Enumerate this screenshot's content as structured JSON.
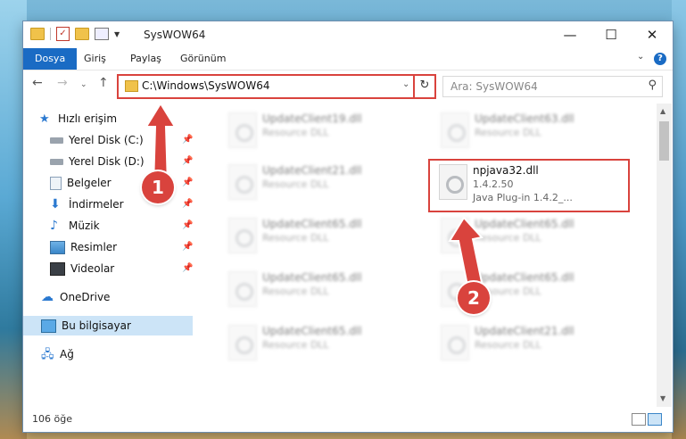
{
  "window": {
    "title": "SysWOW64",
    "minimize": "—",
    "maximize": "☐",
    "close": "✕"
  },
  "ribbon": {
    "tabs": [
      "Dosya",
      "Giriş",
      "Paylaş",
      "Görünüm"
    ],
    "help": "?"
  },
  "address": {
    "path": "C:\\Windows\\SysWOW64",
    "search_placeholder": "Ara: SysWOW64"
  },
  "sidebar": {
    "quick_access": "Hızlı erişim",
    "items": [
      "Yerel Disk (C:)",
      "Yerel Disk (D:)",
      "Belgeler",
      "İndirmeler",
      "Müzik",
      "Resimler",
      "Videolar"
    ],
    "onedrive": "OneDrive",
    "this_pc": "Bu bilgisayar",
    "network": "Ağ"
  },
  "files": [
    {
      "name": "UpdateClient19.dll",
      "desc": "Resource DLL"
    },
    {
      "name": "UpdateClient63.dll",
      "desc": "Resource DLL"
    },
    {
      "name": "UpdateClient21.dll",
      "desc": "Resource DLL"
    },
    {
      "name": "npjava32.dll",
      "version": "1.4.2.50",
      "desc": "Java Plug-in 1.4.2_..."
    },
    {
      "name": "UpdateClient65.dll",
      "desc": "Resource DLL"
    },
    {
      "name": "UpdateClient65.dll",
      "desc": "Resource DLL"
    },
    {
      "name": "UpdateClient65.dll",
      "desc": "Resource DLL"
    },
    {
      "name": "UpdateClient65.dll",
      "desc": "Resource DLL"
    },
    {
      "name": "UpdateClient65.dll",
      "desc": "Resource DLL"
    },
    {
      "name": "UpdateClient21.dll",
      "desc": "Resource DLL"
    }
  ],
  "status": {
    "count": "106 öğe"
  },
  "annotations": {
    "step1": "1",
    "step2": "2",
    "color": "#d9433d"
  }
}
